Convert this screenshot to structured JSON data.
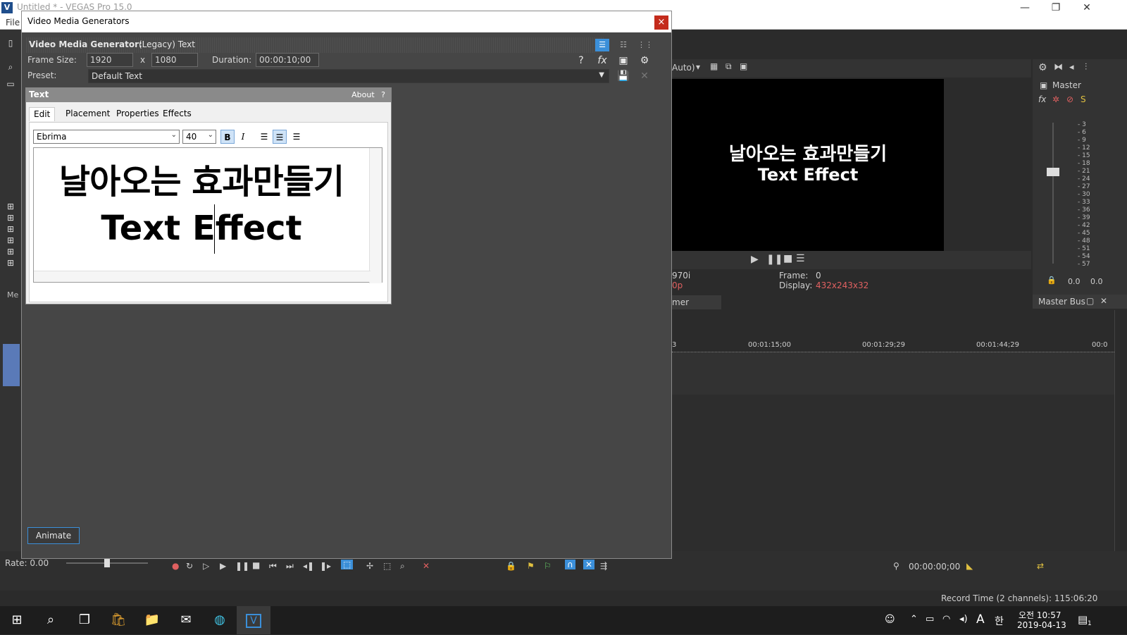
{
  "app": {
    "title": "Untitled * - VEGAS Pro 15.0",
    "logo": "V",
    "menu_file": "File",
    "win_minimize": "—",
    "win_restore": "❐",
    "win_close": "✕"
  },
  "preview": {
    "toolbar_auto": "Auto)",
    "line1": "날아오는 효과만들기",
    "line2": "Text Effect",
    "frame_label": "Frame:",
    "frame_value": "0",
    "display_label": "Display:",
    "display_value": "432x243x32",
    "left_info1": "970i",
    "left_info2": "0p",
    "tab_label": "mer"
  },
  "master": {
    "label": "Master",
    "bus_tab": "Master Bus",
    "scale": [
      "3",
      "6",
      "9",
      "12",
      "15",
      "18",
      "21",
      "24",
      "27",
      "30",
      "33",
      "36",
      "39",
      "42",
      "45",
      "48",
      "51",
      "54",
      "57"
    ],
    "left_value": "0.0",
    "right_value": "0.0"
  },
  "timeline": {
    "ticks": [
      "00:01:15;00",
      "00:01:29;29",
      "00:01:44;29",
      "00:0"
    ],
    "left_tick": "3"
  },
  "transport": {
    "rate": "Rate: 0.00",
    "timecode": "00:00:00;00",
    "record_time": "Record Time (2 channels): 115:06:20"
  },
  "left_panel": {
    "tab_label": "Me"
  },
  "dialog": {
    "title": "Video Media Generators",
    "close": "×",
    "generator_label": "Video Media Generator:",
    "generator_value": "(Legacy) Text",
    "frame_size_label": "Frame Size:",
    "frame_w": "1920",
    "frame_x": "x",
    "frame_h": "1080",
    "duration_label": "Duration:",
    "duration": "00:00:10;00",
    "preset_label": "Preset:",
    "preset_value": "Default Text",
    "animate_button": "Animate"
  },
  "text_plugin": {
    "title": "Text",
    "about": "About",
    "help": "?",
    "tabs": [
      "Edit",
      "Placement",
      "Properties",
      "Effects"
    ],
    "font": "Ebrima",
    "size": "40",
    "bold": "B",
    "italic": "I",
    "line1": "날아오는 효과만들기",
    "line2": "Text Effect"
  },
  "taskbar": {
    "clock_time": "오전 10:57",
    "clock_date": "2019-04-13",
    "ime_a": "A",
    "ime_han": "한",
    "notif_count": "1"
  },
  "colors": {
    "accent": "#3b8fd9",
    "close_red": "#c42b1c",
    "dialog_bg": "#464646"
  }
}
